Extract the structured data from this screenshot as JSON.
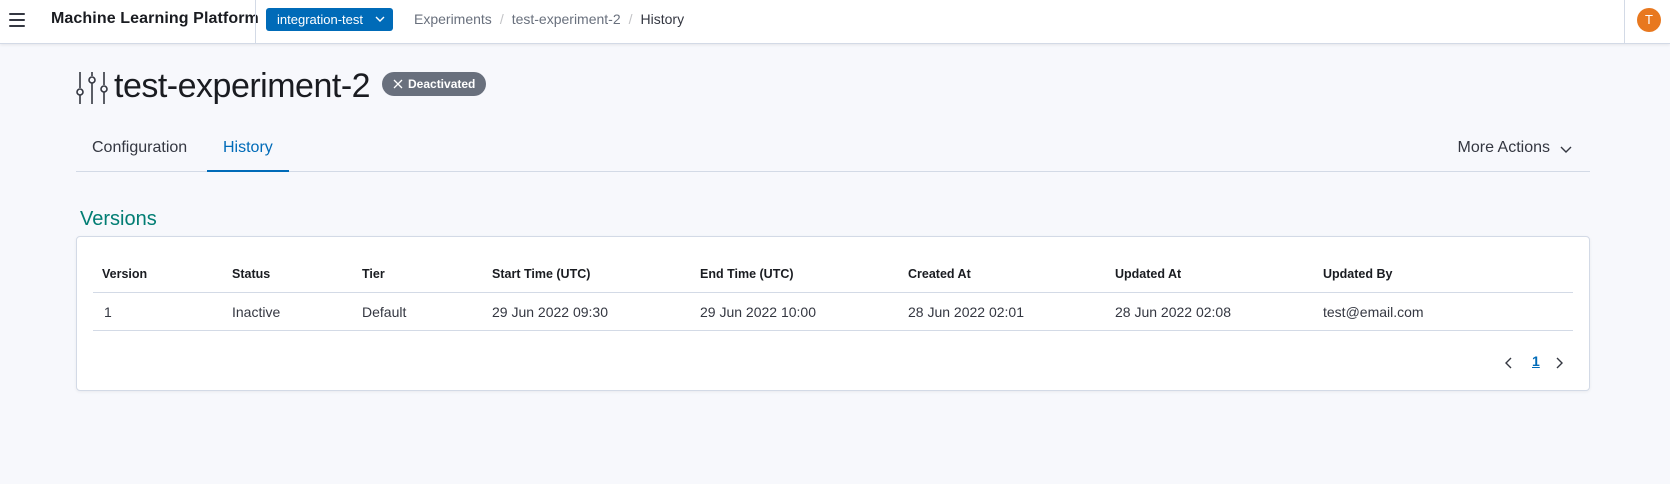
{
  "header": {
    "app_title": "Machine Learning Platform",
    "project": "integration-test",
    "breadcrumb": [
      "Experiments",
      "test-experiment-2",
      "History"
    ],
    "avatar_initial": "T"
  },
  "page": {
    "title": "test-experiment-2",
    "status_badge": "Deactivated"
  },
  "tabs": [
    {
      "label": "Configuration",
      "active": false
    },
    {
      "label": "History",
      "active": true
    }
  ],
  "more_actions_label": "More Actions",
  "versions": {
    "title": "Versions",
    "columns": [
      "Version",
      "Status",
      "Tier",
      "Start Time (UTC)",
      "End Time (UTC)",
      "Created At",
      "Updated At",
      "Updated By"
    ],
    "rows": [
      [
        "1",
        "Inactive",
        "Default",
        "29 Jun 2022 09:30",
        "29 Jun 2022 10:00",
        "28 Jun 2022 02:01",
        "28 Jun 2022 02:08",
        "test@email.com"
      ]
    ],
    "pagination": {
      "current_page": "1"
    }
  },
  "colors": {
    "accent": "#006bb8",
    "section_title": "#017d73",
    "badge_bg": "#69707d",
    "avatar_bg": "#e8781f"
  }
}
